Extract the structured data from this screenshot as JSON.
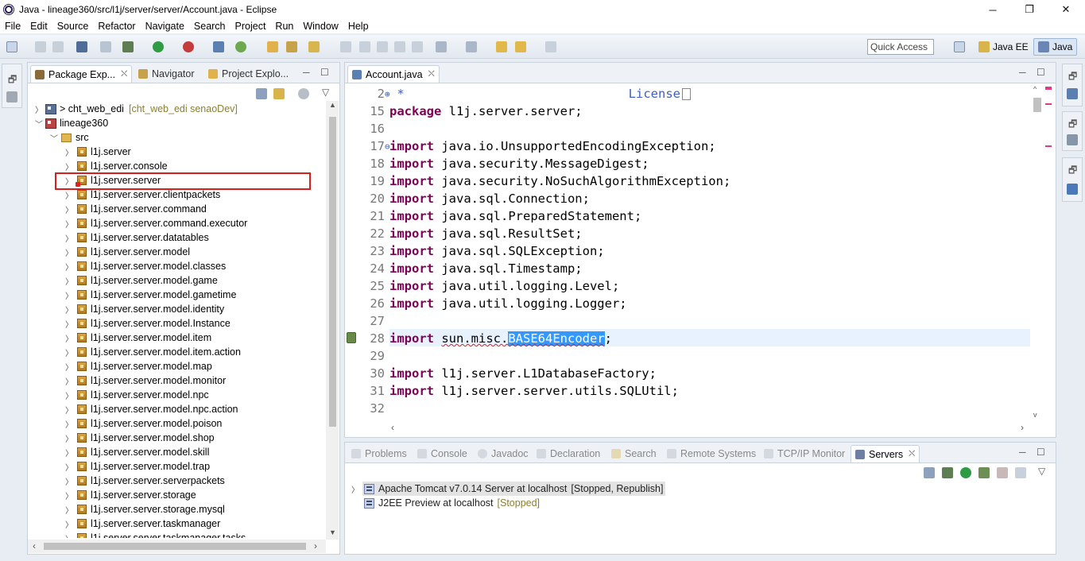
{
  "window": {
    "title": "Java - lineage360/src/l1j/server/server/Account.java - Eclipse",
    "minimize": "─",
    "maximize": "❐",
    "close": "✕"
  },
  "menu": [
    "File",
    "Edit",
    "Source",
    "Refactor",
    "Navigate",
    "Search",
    "Project",
    "Run",
    "Window",
    "Help"
  ],
  "toolbar": {
    "quick_access": "Quick Access",
    "perspectives": [
      {
        "label": "Java EE",
        "active": false
      },
      {
        "label": "Java",
        "active": true
      }
    ]
  },
  "explorer": {
    "tabs": [
      {
        "label": "Package Exp...",
        "active": true,
        "close": "⛌"
      },
      {
        "label": "Navigator",
        "active": false
      },
      {
        "label": "Project Explo...",
        "active": false
      }
    ],
    "projects": [
      {
        "name": "> cht_web_edi",
        "decoration": "[cht_web_edi senaoDev]",
        "expanded": false
      },
      {
        "name": "lineage360",
        "expanded": true
      }
    ],
    "src_folder": "src",
    "packages": [
      {
        "name": "l1j.server",
        "error": false
      },
      {
        "name": "l1j.server.console",
        "error": false
      },
      {
        "name": "l1j.server.server",
        "error": true,
        "highlighted": true
      },
      {
        "name": "l1j.server.server.clientpackets",
        "error": false
      },
      {
        "name": "l1j.server.server.command",
        "error": false
      },
      {
        "name": "l1j.server.server.command.executor",
        "error": false
      },
      {
        "name": "l1j.server.server.datatables",
        "error": false
      },
      {
        "name": "l1j.server.server.model",
        "error": false
      },
      {
        "name": "l1j.server.server.model.classes",
        "error": false
      },
      {
        "name": "l1j.server.server.model.game",
        "error": false
      },
      {
        "name": "l1j.server.server.model.gametime",
        "error": false
      },
      {
        "name": "l1j.server.server.model.identity",
        "error": false
      },
      {
        "name": "l1j.server.server.model.Instance",
        "error": false
      },
      {
        "name": "l1j.server.server.model.item",
        "error": false
      },
      {
        "name": "l1j.server.server.model.item.action",
        "error": false
      },
      {
        "name": "l1j.server.server.model.map",
        "error": false
      },
      {
        "name": "l1j.server.server.model.monitor",
        "error": false
      },
      {
        "name": "l1j.server.server.model.npc",
        "error": false
      },
      {
        "name": "l1j.server.server.model.npc.action",
        "error": false
      },
      {
        "name": "l1j.server.server.model.poison",
        "error": false
      },
      {
        "name": "l1j.server.server.model.shop",
        "error": false
      },
      {
        "name": "l1j.server.server.model.skill",
        "error": false
      },
      {
        "name": "l1j.server.server.model.trap",
        "error": false
      },
      {
        "name": "l1j.server.server.serverpackets",
        "error": false
      },
      {
        "name": "l1j.server.server.storage",
        "error": false
      },
      {
        "name": "l1j.server.server.storage.mysql",
        "error": false
      },
      {
        "name": "l1j.server.server.taskmanager",
        "error": false
      },
      {
        "name": "l1j.server.server.taskmanager.tasks",
        "error": false
      }
    ]
  },
  "editor": {
    "tab": {
      "label": "Account.java",
      "close": "⛌"
    },
    "folded_header": {
      "line": "2",
      "text": " *",
      "license": "License"
    },
    "lines": [
      {
        "n": "15",
        "kw": "package",
        "rest": " l1j.server.server;"
      },
      {
        "n": "16",
        "kw": "",
        "rest": ""
      },
      {
        "n": "17",
        "kw": "import",
        "rest": " java.io.UnsupportedEncodingException;",
        "fold": true
      },
      {
        "n": "18",
        "kw": "import",
        "rest": " java.security.MessageDigest;"
      },
      {
        "n": "19",
        "kw": "import",
        "rest": " java.security.NoSuchAlgorithmException;"
      },
      {
        "n": "20",
        "kw": "import",
        "rest": " java.sql.Connection;"
      },
      {
        "n": "21",
        "kw": "import",
        "rest": " java.sql.PreparedStatement;"
      },
      {
        "n": "22",
        "kw": "import",
        "rest": " java.sql.ResultSet;"
      },
      {
        "n": "23",
        "kw": "import",
        "rest": " java.sql.SQLException;"
      },
      {
        "n": "24",
        "kw": "import",
        "rest": " java.sql.Timestamp;"
      },
      {
        "n": "25",
        "kw": "import",
        "rest": " java.util.logging.Level;"
      },
      {
        "n": "26",
        "kw": "import",
        "rest": " java.util.logging.Logger;"
      },
      {
        "n": "27",
        "kw": "",
        "rest": ""
      },
      {
        "n": "28",
        "kw": "import",
        "pre": " ",
        "squig": "sun.misc.",
        "sel": "BASE64Encoder",
        "post": ";",
        "current": true
      },
      {
        "n": "29",
        "kw": "",
        "rest": ""
      },
      {
        "n": "30",
        "kw": "import",
        "rest": " l1j.server.L1DatabaseFactory;"
      },
      {
        "n": "31",
        "kw": "import",
        "rest": " l1j.server.server.utils.SQLUtil;"
      },
      {
        "n": "32",
        "kw": "",
        "rest": ""
      }
    ]
  },
  "bottom": {
    "tabs": [
      {
        "label": "Problems",
        "active": false
      },
      {
        "label": "Console",
        "active": false
      },
      {
        "label": "Javadoc",
        "active": false
      },
      {
        "label": "Declaration",
        "active": false
      },
      {
        "label": "Search",
        "active": false
      },
      {
        "label": "Remote Systems",
        "active": false
      },
      {
        "label": "TCP/IP Monitor",
        "active": false
      },
      {
        "label": "Servers",
        "active": true,
        "close": "⛌"
      }
    ],
    "servers": [
      {
        "name": "Apache Tomcat v7.0.14 Server at localhost",
        "state": "[Stopped, Republish]",
        "selected": true
      },
      {
        "name": "J2EE Preview at localhost",
        "state": "[Stopped]",
        "selected": false
      }
    ]
  }
}
